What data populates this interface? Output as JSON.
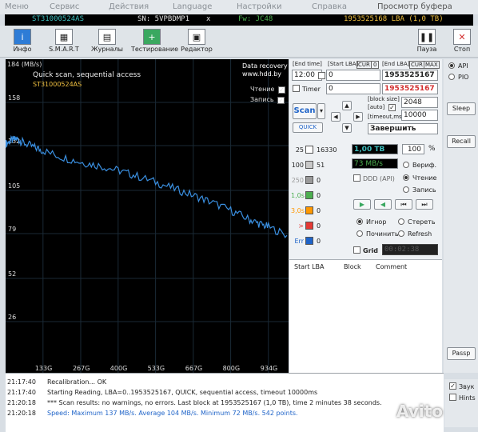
{
  "menu": [
    "Меню",
    "Сервис",
    "Действия",
    "Language",
    "Настройки",
    "Справка",
    "Просмотр буфера"
  ],
  "status": {
    "model": "ST31000524AS",
    "serial": "SN: 5VPBDMP1",
    "close": "x",
    "firmware": "Fw: JC48",
    "capacity": "1953525168 LBA (1,0 TB)"
  },
  "toolbar": [
    "Инфо",
    "S.M.A.R.T",
    "Журналы",
    "Тестирование",
    "Редактор",
    "Пауза",
    "Стоп"
  ],
  "graph": {
    "unit_label": "184 (MB/s)",
    "title": "Quick scan, sequential access",
    "drive": "ST31000524AS",
    "watermark_line1": "Data recovery",
    "watermark_line2": "www.hdd.by",
    "legend_read": "Чтение",
    "legend_write": "Запись",
    "y_ticks": [
      "158",
      "132",
      "105",
      "79",
      "52",
      "26"
    ],
    "x_ticks": [
      "133G",
      "267G",
      "400G",
      "533G",
      "667G",
      "800G",
      "934G"
    ]
  },
  "chart_data": {
    "type": "line",
    "title": "Quick scan, sequential access",
    "ylabel": "(MB/s)",
    "ylim": [
      0,
      184
    ],
    "x_unit": "GB",
    "series": [
      {
        "name": "Чтение",
        "x": [
          0,
          20,
          40,
          60,
          100,
          133,
          200,
          267,
          330,
          400,
          460,
          533,
          600,
          667,
          730,
          800,
          860,
          900,
          934,
          1000
        ],
        "values": [
          133,
          135,
          136,
          134,
          131,
          129,
          125,
          122,
          120,
          117,
          114,
          110,
          106,
          102,
          98,
          93,
          88,
          85,
          83,
          78
        ]
      }
    ]
  },
  "controls": {
    "end_time_label": "End time",
    "start_lba_label": "Start LBA",
    "cur_label": "CUR",
    "zero_label": "0",
    "end_lba_label": "End LBA",
    "max_label": "MAX",
    "time_value": "12:00",
    "start_lba_value": "0",
    "end_lba_value": "1953525167",
    "timer_label": "Timer",
    "timer_value": "0",
    "end_lba_red": "1953525167",
    "scan_label": "Scan",
    "quick_label": "QUICK",
    "block_size_label": "block size",
    "auto_label": "auto",
    "block_size_value": "2048",
    "timeout_label": "timeout,ms",
    "timeout_value": "10000",
    "finish_label": "Завершить"
  },
  "counters": [
    {
      "label": "25",
      "value": "16330",
      "color": "#ffffff"
    },
    {
      "label": "100",
      "value": "51",
      "color": "#c8c8c8"
    },
    {
      "label": "250",
      "value": "0",
      "color": "#9a9a9a"
    },
    {
      "label": "1,0s",
      "value": "0",
      "color": "#4caf50"
    },
    {
      "label": "3,0s",
      "value": "0",
      "color": "#ff9800"
    },
    {
      "label": ">",
      "value": "0",
      "color": "#e53935"
    },
    {
      "label": "Err",
      "value": "0",
      "color": "#1e63c8"
    }
  ],
  "progress": {
    "scanned": "1,00 TB",
    "percent": "100",
    "percent_unit": "%",
    "speed": "73 MB/s",
    "verify_label": "Вериф.",
    "read_label": "Чтение",
    "write_label": "Запись",
    "ddd_label": "DDD (API)"
  },
  "actions": {
    "ignore": "Игнор",
    "erase": "Стереть",
    "repair": "Починить",
    "refresh": "Refresh",
    "grid_label": "Grid",
    "elapsed": "00:02:38"
  },
  "table_headers": [
    "Start LBA",
    "Block",
    "Comment"
  ],
  "right": {
    "api": "API",
    "pio": "PIO",
    "sleep": "Sleep",
    "recall": "Recall",
    "passp": "Passp",
    "sound": "Звук",
    "hints": "Hints"
  },
  "log": [
    {
      "time": "21:17:40",
      "text": "Recalibration... OK",
      "color": "#222"
    },
    {
      "time": "21:17:40",
      "text": "Starting Reading, LBA=0..1953525167, QUICK, sequential access, timeout 10000ms",
      "color": "#222"
    },
    {
      "time": "21:20:18",
      "text": "*** Scan results: no warnings, no errors. Last block at 1953525167 (1,0 TB), time 2 minutes 38 seconds.",
      "color": "#222"
    },
    {
      "time": "21:20:18",
      "text": "Speed: Maximum 137 MB/s. Average 104 MB/s. Minimum 72 MB/s. 542 points.",
      "color": "#1e63c8"
    }
  ],
  "watermark": "Avito"
}
